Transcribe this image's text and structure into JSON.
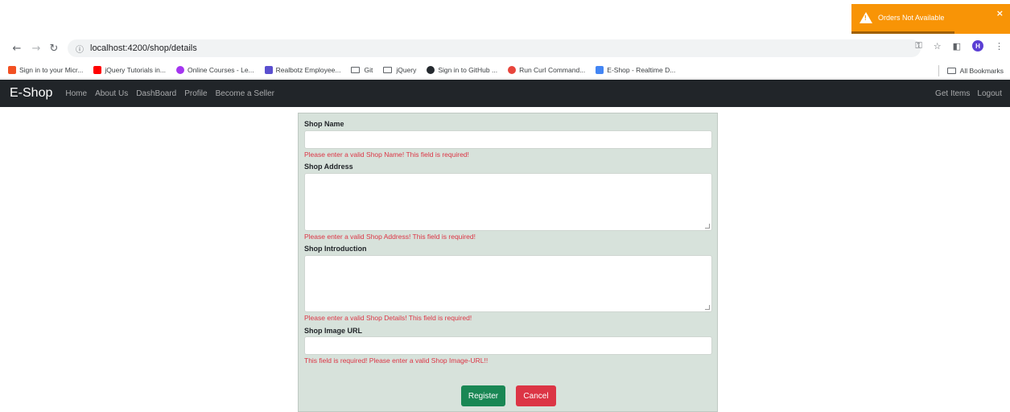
{
  "browser": {
    "url": "localhost:4200/shop/details",
    "profile_initial": "H",
    "bookmarks": [
      {
        "label": "Sign in to your Micr...",
        "icon": "microsoft-icon",
        "color": "#f25022"
      },
      {
        "label": "jQuery Tutorials in...",
        "icon": "youtube-icon",
        "color": "#ff0000"
      },
      {
        "label": "Online Courses - Le...",
        "icon": "udemy-icon",
        "color": "#a435f0"
      },
      {
        "label": "Realbotz Employee...",
        "icon": "realbotz-icon",
        "color": "#5a4fcf"
      },
      {
        "label": "Git",
        "icon": "folder-icon"
      },
      {
        "label": "jQuery",
        "icon": "folder-icon"
      },
      {
        "label": "Sign in to GitHub ...",
        "icon": "github-icon",
        "color": "#24292e"
      },
      {
        "label": "Run Curl Command...",
        "icon": "curl-icon",
        "color": "#e8453c"
      },
      {
        "label": "E-Shop - Realtime D...",
        "icon": "google-icon",
        "color": "#4285f4"
      }
    ],
    "all_bookmarks": "All Bookmarks"
  },
  "navbar": {
    "brand": "E-Shop",
    "links": [
      "Home",
      "About Us",
      "DashBoard",
      "Profile",
      "Become a Seller"
    ],
    "right_links": [
      "Get Items",
      "Logout"
    ]
  },
  "form": {
    "shop_name": {
      "label": "Shop Name",
      "value": "",
      "error": "Please enter a valid Shop Name! This field is required!"
    },
    "shop_address": {
      "label": "Shop Address",
      "value": "",
      "error": "Please enter a valid Shop Address! This field is required!"
    },
    "shop_intro": {
      "label": "Shop Introduction",
      "value": "",
      "error": "Please enter a valid Shop Details! This field is required!"
    },
    "shop_image": {
      "label": "Shop Image URL",
      "value": "",
      "error": "This field is required! Please enter a valid Shop Image-URL!!"
    },
    "register_label": "Register",
    "cancel_label": "Cancel"
  },
  "toast": {
    "message": "Orders Not Available",
    "close": "×",
    "progress": 0.65,
    "color": "#f89406"
  },
  "colors": {
    "navbar": "#212529",
    "form_bg": "#d7e2db",
    "error": "#dc3545",
    "register": "#198754",
    "cancel": "#dc3545"
  }
}
